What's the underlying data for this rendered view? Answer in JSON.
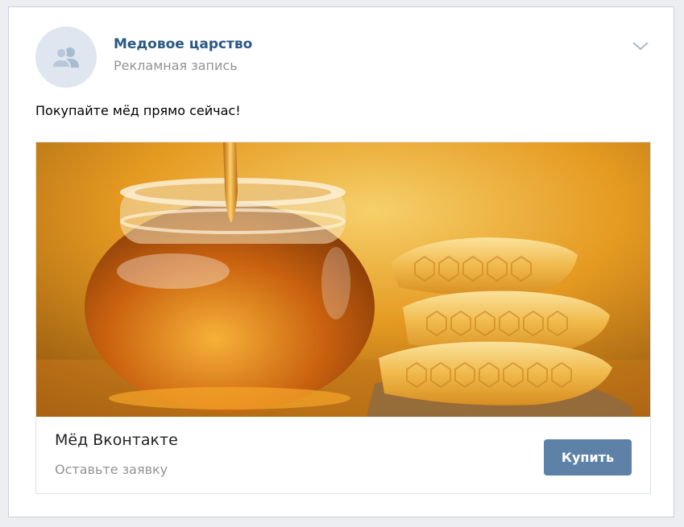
{
  "post": {
    "author": "Медовое царство",
    "label": "Рекламная запись",
    "text": "Покупайте мёд прямо сейчас!"
  },
  "icons": {
    "avatar": "community-group-icon",
    "menu": "chevron-down-icon"
  },
  "ad": {
    "image": "honey-jar-and-honeycomb-photo",
    "title": "Мёд Вконтакте",
    "subtitle": "Оставьте заявку",
    "button_label": "Купить"
  },
  "colors": {
    "link": "#2a5885",
    "button": "#5e81a8",
    "muted_text": "#939393",
    "avatar_bg": "#dfe6ef"
  }
}
